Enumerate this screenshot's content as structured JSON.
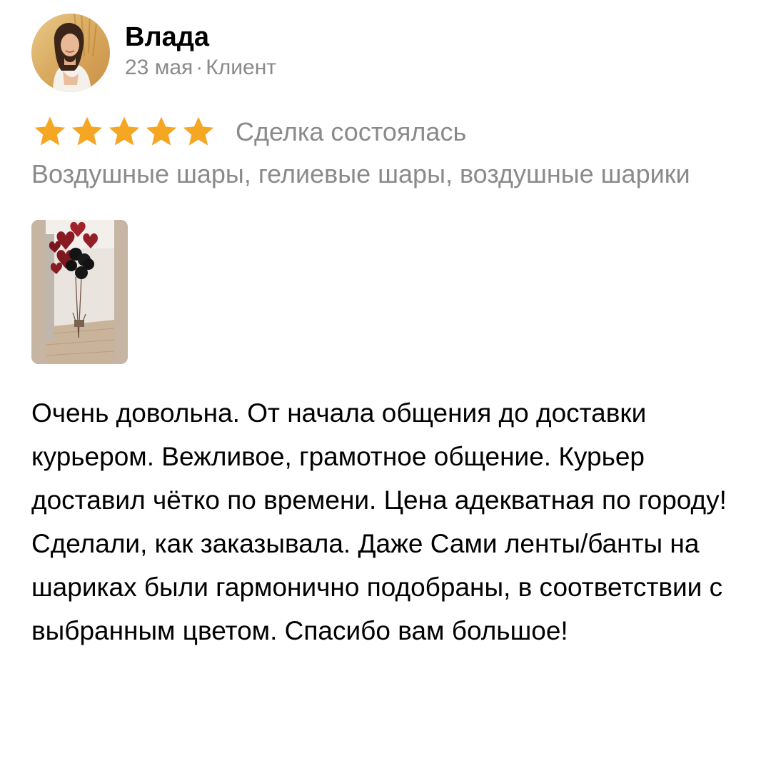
{
  "review": {
    "author": {
      "name": "Влада",
      "date": "23 мая",
      "separator": "·",
      "role": "Клиент",
      "avatar_icon": "user-avatar-photo"
    },
    "rating": {
      "stars": 5,
      "max_stars": 5,
      "star_color": "#f5a623",
      "status": "Сделка состоялась"
    },
    "tags": "Воздушные шары, гелиевые шары, воздушные шарики",
    "photo": {
      "icon": "balloons-photo-thumbnail"
    },
    "text": {
      "paragraph_1": "Очень довольна. От начала общения до доставки курьером. Вежливое, грамотное общение. Курьер доставил чётко по времени. Цена адекватная по городу!",
      "paragraph_2": "Сделали, как заказывала. Даже Сами ленты/банты на шариках были гармонично подобраны, в соответствии с выбранным цветом. Спасибо вам большое!"
    }
  }
}
